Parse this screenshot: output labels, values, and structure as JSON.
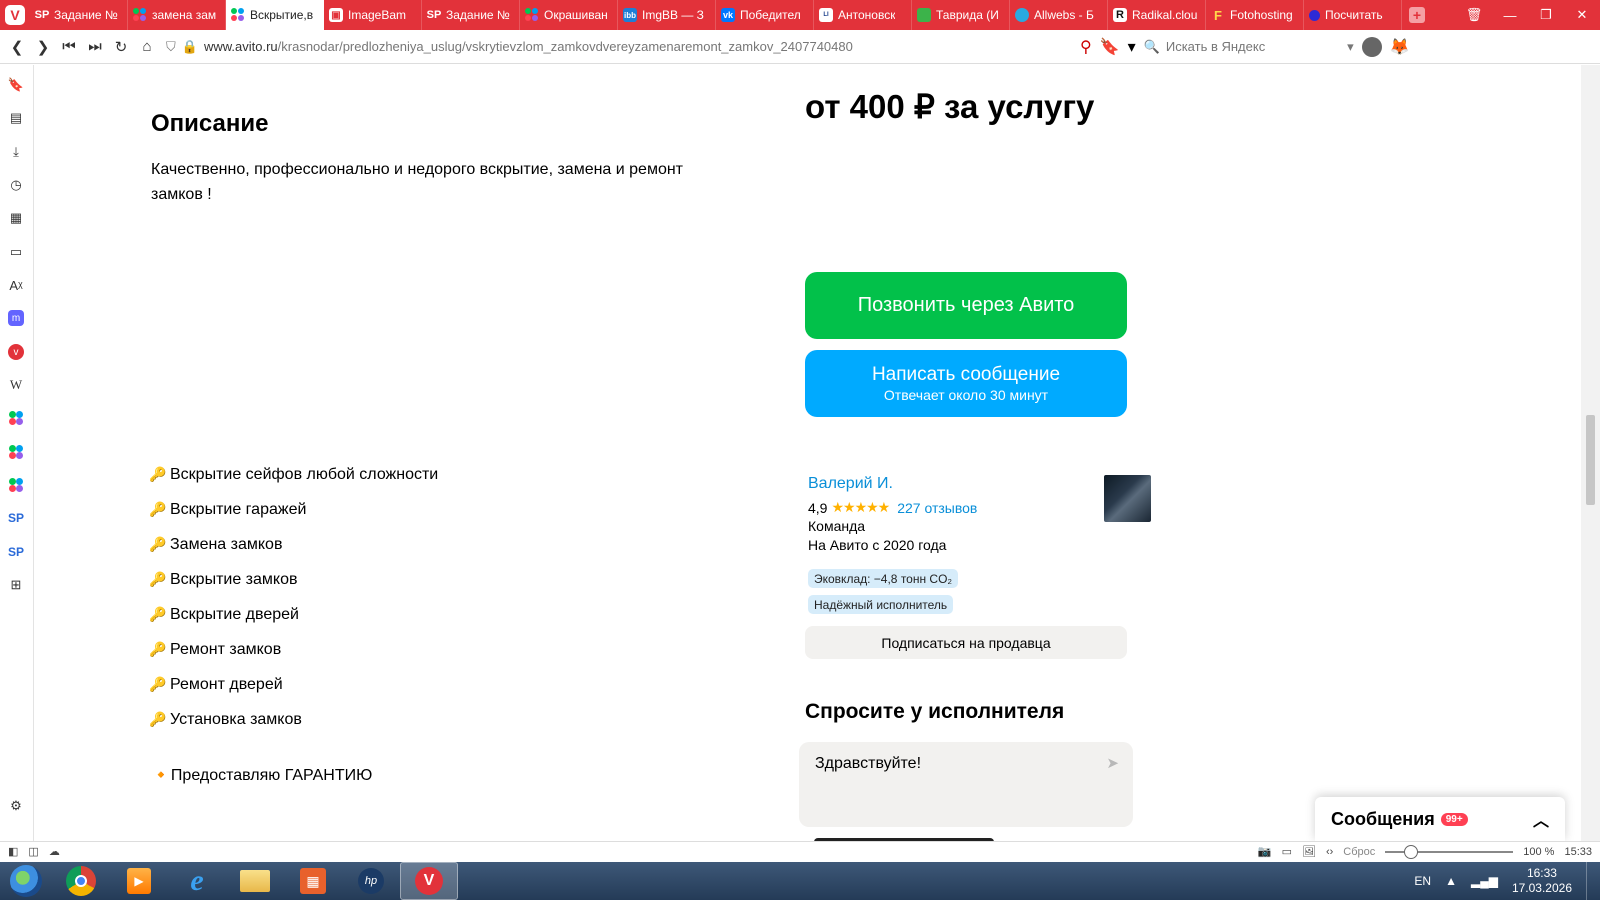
{
  "browser": {
    "tabs": [
      {
        "label": "Задание №",
        "icon": "sp-icon"
      },
      {
        "label": "замена зам",
        "icon": "avito-icon"
      },
      {
        "label": "Вскрытие,в",
        "icon": "avito-icon",
        "active": true
      },
      {
        "label": "ImageBam",
        "icon": "imagebam-icon"
      },
      {
        "label": "Задание №",
        "icon": "sp-icon"
      },
      {
        "label": "Окрашиван",
        "icon": "avito-icon"
      },
      {
        "label": "ImgBB — З",
        "icon": "imgbb-icon"
      },
      {
        "label": "Победител",
        "icon": "vk-icon"
      },
      {
        "label": "Антоновск",
        "icon": "liveinternet-icon"
      },
      {
        "label": "Таврида (И",
        "icon": "green-square-icon"
      },
      {
        "label": "Allwebs - Б",
        "icon": "allwebs-icon"
      },
      {
        "label": "Radikal.clou",
        "icon": "radikal-icon"
      },
      {
        "label": "Fotohosting",
        "icon": "fotohosting-icon"
      },
      {
        "label": "Посчитать",
        "icon": "blue-dot-icon"
      }
    ],
    "url_host": "www.avito.ru",
    "url_path": "/krasnodar/predlozheniya_uslug/vskrytievzlom_zamkovdvereyzamenaremont_zamkov_2407740480",
    "search_placeholder": "Искать в Яндекс"
  },
  "page": {
    "description_title": "Описание",
    "description_text": "Качественно, профессионально и недорого вскрытие, замена и ремонт замков !",
    "services": [
      "Вскрытие сейфов любой сложности",
      "Вскрытие гаражей",
      "Замена замков",
      "Вскрытие замков",
      "Вскрытие дверей",
      "Ремонт замков",
      "Ремонт дверей",
      "Установка замков"
    ],
    "service_glyph": "🔑",
    "guarantee": "🔸Предоставляю ГАРАНТИЮ",
    "price": "от 400 ₽ за услугу",
    "call_button": "Позвонить через Авито",
    "message_button": "Написать сообщение",
    "message_button_sub": "Отвечает около 30 минут",
    "seller": {
      "name": "Валерий И.",
      "rating": "4,9",
      "stars": "★★★★★",
      "reviews": "227 отзывов",
      "type": "Команда",
      "since": "На Авито с 2020 года",
      "eco_badge": "Эковклад: −4,8 тонн CO₂",
      "reliable_badge": "Надёжный исполнитель",
      "subscribe_button": "Подписаться на продавца"
    },
    "ask": {
      "title": "Спросите у исполнителя",
      "input_value": "Здравствуйте!"
    },
    "messages_panel": {
      "title": "Сообщения",
      "count": "99+"
    }
  },
  "statusbar": {
    "reset_label": "Сброс",
    "zoom": "100 %",
    "time": "15:33"
  },
  "taskbar": {
    "lang": "EN",
    "time": "16:33",
    "date": "17.03.2026"
  },
  "colors": {
    "browser_accent": "#e2323a",
    "call_green": "#02c14a",
    "message_blue": "#00aaff",
    "link_blue": "#0a8fd8",
    "star_yellow": "#ffb100"
  }
}
